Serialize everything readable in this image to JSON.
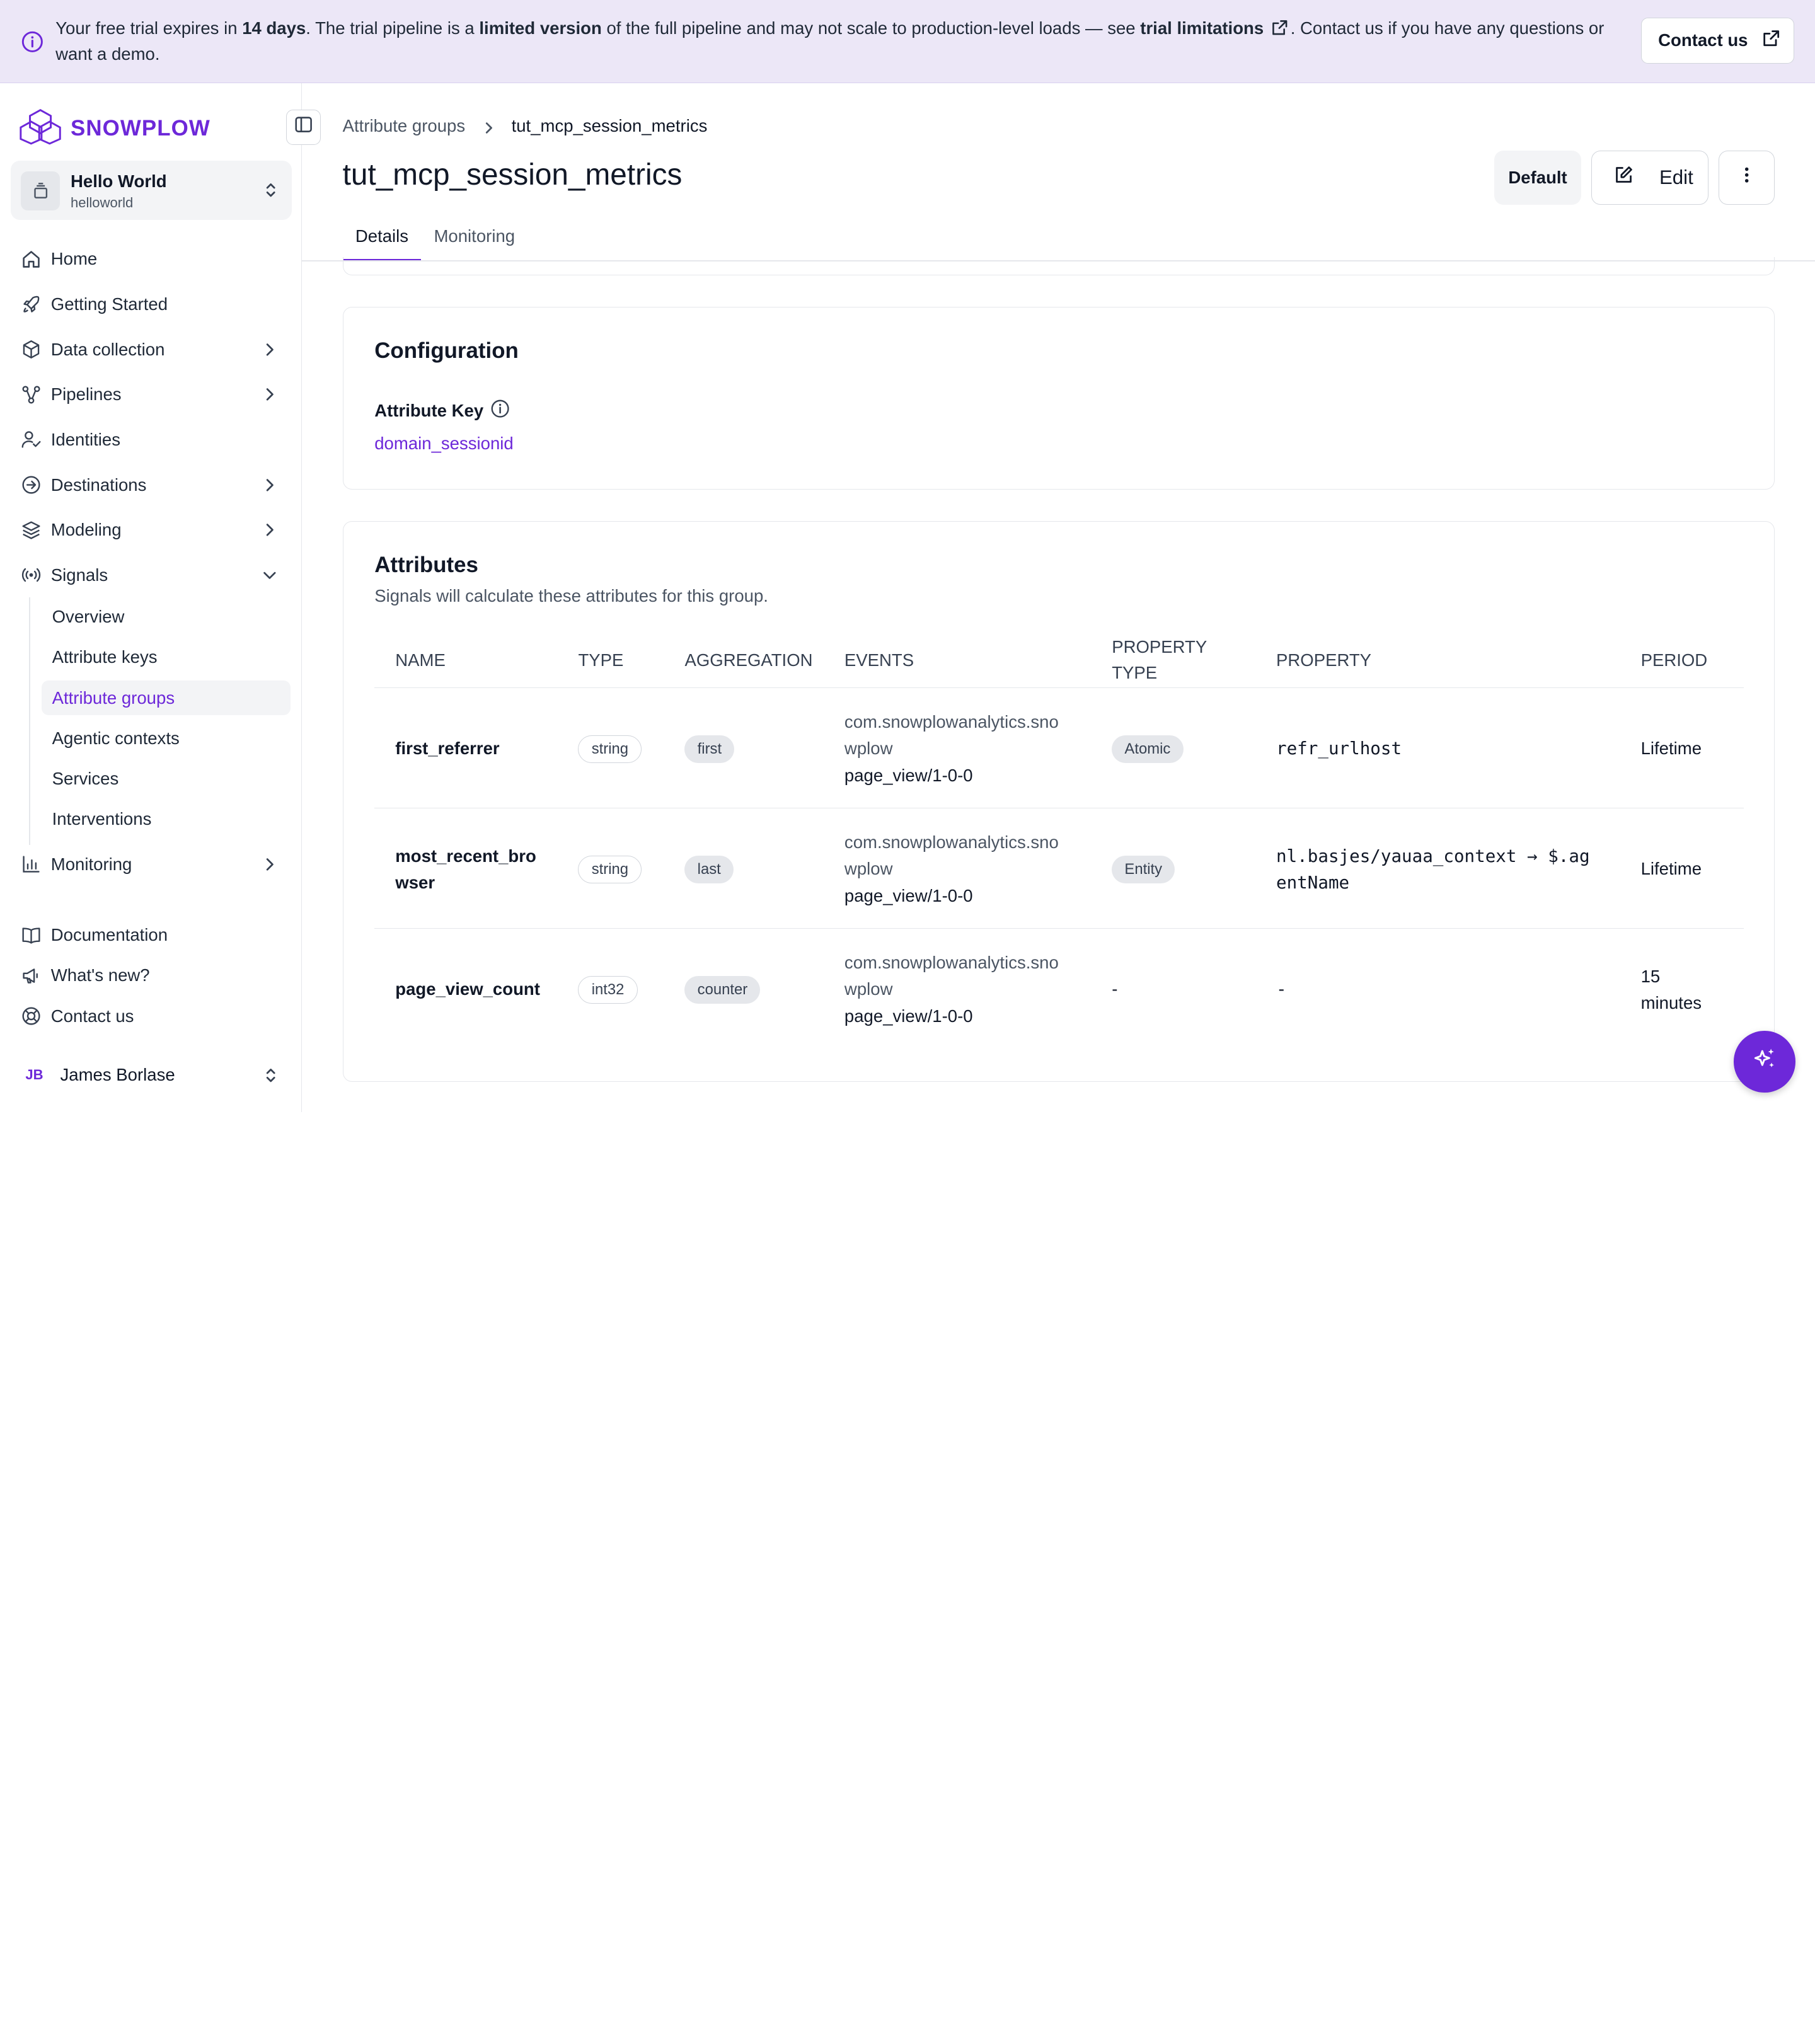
{
  "banner": {
    "text_1": "Your free trial expires in ",
    "days": "14 days",
    "text_2": ". The trial pipeline is a ",
    "limited": "limited version",
    "text_3": " of the full pipeline and may not scale to production-level loads — see ",
    "trial_limitations": "trial limitations",
    "text_4": ". Contact us if you have any questions or want a demo.",
    "contact_button": "Contact us",
    "background": "#ece7f7"
  },
  "brand": {
    "logo_text": "SNOWPLOW",
    "accent": "#6d28d9"
  },
  "org": {
    "name": "Hello World",
    "slug": "helloworld"
  },
  "nav": {
    "home": "Home",
    "getting_started": "Getting Started",
    "data_collection": "Data collection",
    "pipelines": "Pipelines",
    "identities": "Identities",
    "destinations": "Destinations",
    "modeling": "Modeling",
    "signals": "Signals",
    "signals_sub": {
      "overview": "Overview",
      "attribute_keys": "Attribute keys",
      "attribute_groups": "Attribute groups",
      "agentic_contexts": "Agentic contexts",
      "services": "Services",
      "interventions": "Interventions"
    },
    "monitoring": "Monitoring",
    "documentation": "Documentation",
    "whats_new": "What's new?",
    "contact_us": "Contact us"
  },
  "user": {
    "initials": "JB",
    "name": "James Borlase"
  },
  "breadcrumb": {
    "parent": "Attribute groups",
    "current": "tut_mcp_session_metrics"
  },
  "page": {
    "title": "tut_mcp_session_metrics"
  },
  "actions": {
    "default": "Default",
    "edit": "Edit"
  },
  "tabs": {
    "details": "Details",
    "monitoring": "Monitoring"
  },
  "configuration": {
    "title": "Configuration",
    "attribute_key_label": "Attribute Key",
    "attribute_key_value": "domain_sessionid"
  },
  "attributes": {
    "title": "Attributes",
    "subtitle": "Signals will calculate these attributes for this group.",
    "columns": {
      "name": "Name",
      "type": "Type",
      "aggregation": "Aggregation",
      "events": "Events",
      "property_type_1": "Property",
      "property_type_2": "Type",
      "property": "Property",
      "period": "Period"
    },
    "rows": [
      {
        "name": "first_referrer",
        "type": "string",
        "aggregation": "first",
        "event_line1": "com.snowplowanalytics.sno",
        "event_line2": "wplow",
        "event_line3": "page_view/1-0-0",
        "property_type": "Atomic",
        "property": "refr_urlhost",
        "period": "Lifetime"
      },
      {
        "name_line1": "most_recent_bro",
        "name_line2": "wser",
        "type": "string",
        "aggregation": "last",
        "event_line1": "com.snowplowanalytics.sno",
        "event_line2": "wplow",
        "event_line3": "page_view/1-0-0",
        "property_type": "Entity",
        "property_line1": "nl.basjes/yauaa_context → $.ag",
        "property_line2": "entName",
        "period": "Lifetime"
      },
      {
        "name": "page_view_count",
        "type": "int32",
        "aggregation": "counter",
        "event_line1": "com.snowplowanalytics.sno",
        "event_line2": "wplow",
        "event_line3": "page_view/1-0-0",
        "property_type": "-",
        "property": "-",
        "period_line1": "15",
        "period_line2": "minutes"
      }
    ]
  }
}
